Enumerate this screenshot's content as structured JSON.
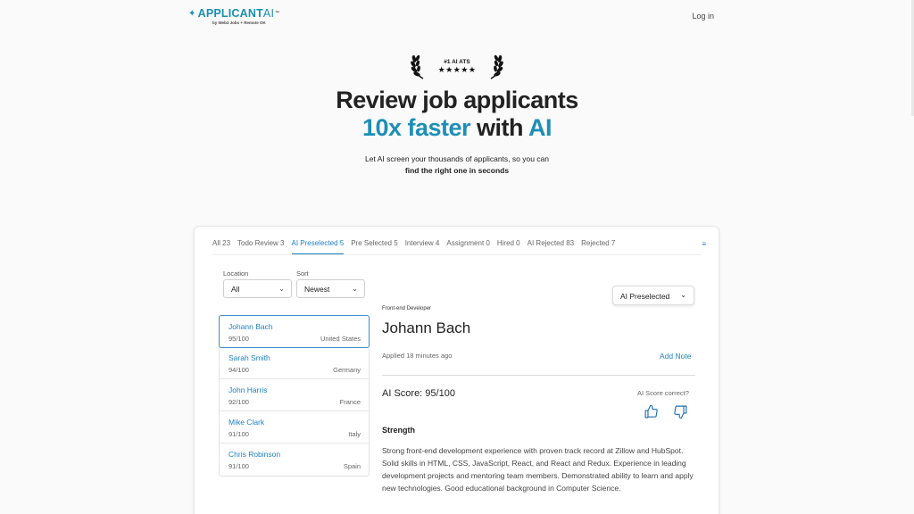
{
  "header": {
    "logo_main": "APPLICANT",
    "logo_ai": "AI",
    "logo_tm": "™",
    "logo_sub": "by Web3 Jobs + Remote OK",
    "login_label": "Log in"
  },
  "badge": {
    "text": "#1 AI ATS",
    "stars": "★★★★★"
  },
  "hero": {
    "line1": "Review job applicants",
    "line2_a": "10x faster",
    "line2_b": " with ",
    "line2_c": "AI",
    "subtitle1": "Let AI screen your thousands of applicants, so you can",
    "subtitle2": "find the right one in seconds"
  },
  "tabs": [
    {
      "label": "All 23"
    },
    {
      "label": "Todo Review 3"
    },
    {
      "label": "AI Preselected 5"
    },
    {
      "label": "Pre Selected 5"
    },
    {
      "label": "Interview 4"
    },
    {
      "label": "Assignment 0"
    },
    {
      "label": "Hired 0"
    },
    {
      "label": "AI Rejected 83"
    },
    {
      "label": "Rejected 7"
    }
  ],
  "tabs_icon": "≡",
  "filters": {
    "location_label": "Location",
    "location_value": "All",
    "sort_label": "Sort",
    "sort_value": "Newest"
  },
  "candidates": [
    {
      "name": "Johann Bach",
      "score": "95/100",
      "location": "United States"
    },
    {
      "name": "Sarah Smith",
      "score": "94/100",
      "location": "Germany"
    },
    {
      "name": "John Harris",
      "score": "92/100",
      "location": "France"
    },
    {
      "name": "Mike Clark",
      "score": "91/100",
      "location": "Italy"
    },
    {
      "name": "Chris Robinson",
      "score": "91/100",
      "location": "Spain"
    }
  ],
  "detail": {
    "status_value": "AI Preselected",
    "role": "Front-end Developer",
    "name": "Johann Bach",
    "applied": "Applied 18 minutes ago",
    "add_note": "Add Note",
    "ai_score": "AI Score: 95/100",
    "score_question": "AI Score correct?",
    "strength_heading": "Strength",
    "strength_text": "Strong front-end development experience with proven track record at Zillow and HubSpot. Solid skills in HTML, CSS, JavaScript, React, and React and Redux. Experience in leading development projects and mentoring team members. Demonstrated ability to learn and apply new technologies. Good educational background in Computer Science."
  },
  "colors": {
    "brand": "#1e8fb5",
    "link": "#1c7fc0"
  }
}
